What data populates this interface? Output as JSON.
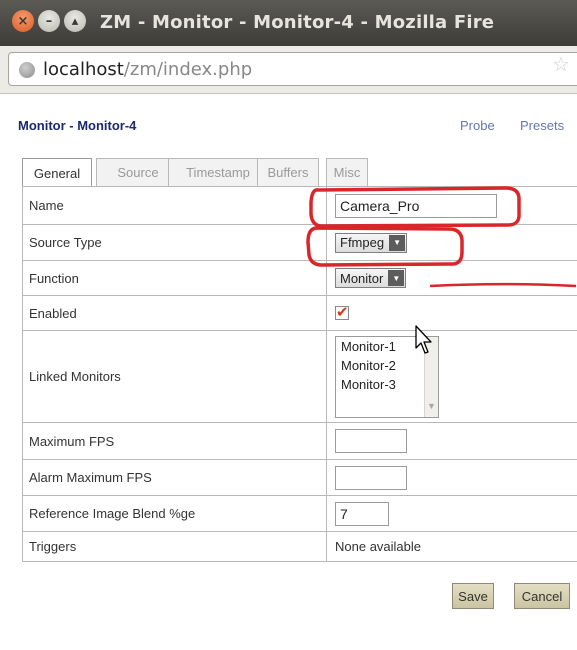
{
  "window": {
    "title": "ZM - Monitor - Monitor-4 - Mozilla Fire"
  },
  "browser": {
    "url_host": "localhost",
    "url_path": "/zm/index.php"
  },
  "page": {
    "title": "Monitor - Monitor-4",
    "links": {
      "probe": "Probe",
      "presets": "Presets"
    }
  },
  "tabs": [
    {
      "label": "General",
      "active": true
    },
    {
      "label": "Source"
    },
    {
      "label": "Timestamp"
    },
    {
      "label": "Buffers"
    },
    {
      "label": "Misc"
    }
  ],
  "form": {
    "name": {
      "label": "Name",
      "value": "Camera_Pro"
    },
    "source_type": {
      "label": "Source Type",
      "value": "Ffmpeg"
    },
    "function": {
      "label": "Function",
      "value": "Monitor"
    },
    "enabled": {
      "label": "Enabled",
      "checked": true
    },
    "linked_monitors": {
      "label": "Linked Monitors",
      "options": [
        "Monitor-1",
        "Monitor-2",
        "Monitor-3"
      ]
    },
    "max_fps": {
      "label": "Maximum FPS",
      "value": ""
    },
    "alarm_max_fps": {
      "label": "Alarm Maximum FPS",
      "value": ""
    },
    "ref_blend": {
      "label": "Reference Image Blend %ge",
      "value": "7"
    },
    "triggers": {
      "label": "Triggers",
      "value": "None available"
    }
  },
  "buttons": {
    "save": "Save",
    "cancel": "Cancel"
  },
  "icons": {
    "close": "close-icon",
    "minimize": "minimize-icon",
    "maximize": "maximize-icon",
    "site": "globe-icon",
    "bookmark": "star-icon",
    "dropdown": "chevron-down-icon",
    "cursor": "mouse-pointer-icon"
  },
  "colors": {
    "annotation": "#d9262b",
    "title_bar": "#4a4945",
    "heading": "#1a2a6c",
    "link": "#6178b0",
    "check": "#d23c1c"
  }
}
